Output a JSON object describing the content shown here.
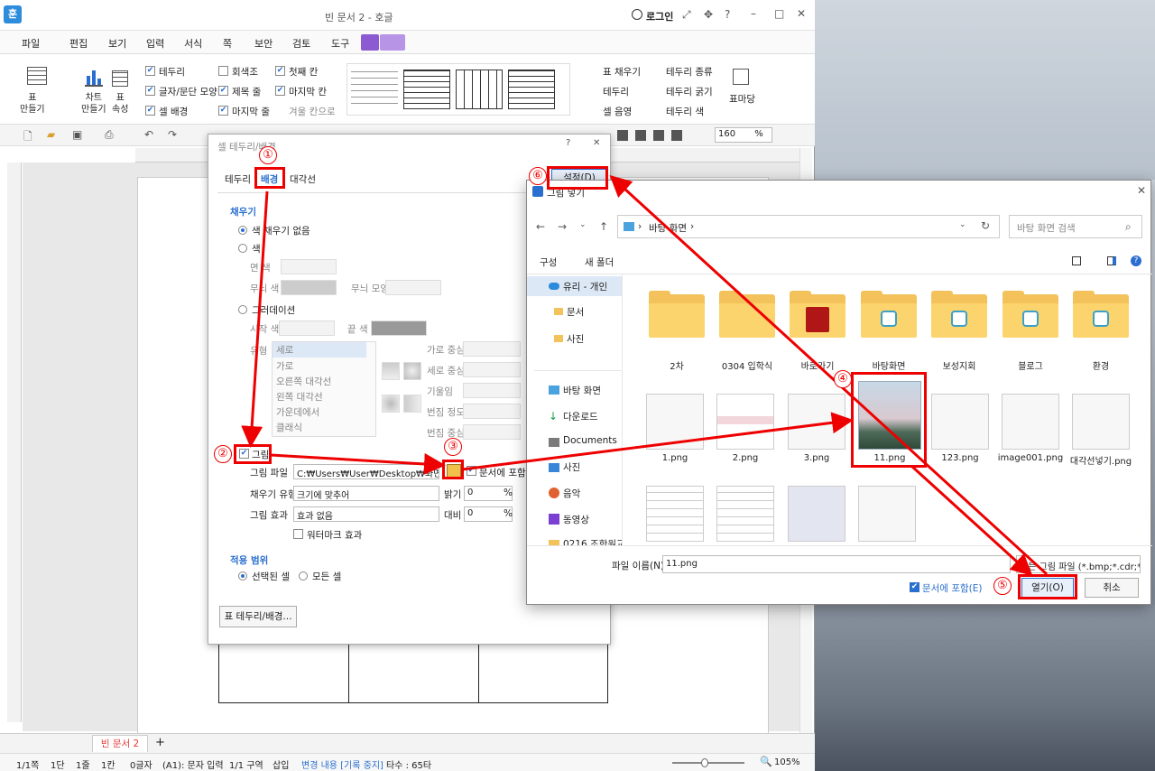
{
  "app": {
    "title": "빈 문서 2 - 호글",
    "login": "로그인",
    "logo": "훈"
  },
  "menu": [
    "파일",
    "편집",
    "보기",
    "입력",
    "서식",
    "쪽",
    "보안",
    "검토",
    "도구"
  ],
  "ribbon": {
    "table_make": "표\n만들기",
    "chart_make": "차트\n만들기",
    "table_prop": "표\n속성",
    "checks_col1": [
      "테두리",
      "글자/문단 모양",
      "셀 배경"
    ],
    "checks_col2": [
      "회색조",
      "제목 줄",
      "마지막 줄"
    ],
    "checks_col3": [
      "첫째 칸",
      "마지막 칸",
      "겨울 칸으로"
    ],
    "right_items": [
      "표 채우기",
      "테두리",
      "셀 음영",
      "테두리 종류",
      "테두리 굵기",
      "테두리 색",
      "표마당"
    ]
  },
  "toolbar2": {
    "zoom": "160",
    "zoom_unit": "%"
  },
  "tabs": {
    "doc_tab": "빈 문서 2"
  },
  "status": {
    "items": [
      "1/1쪽",
      "1단",
      "1줄",
      "1칸",
      "0글자",
      "(A1): 문자 입력",
      "1/1 구역",
      "삽입",
      "변경 내용 [기록 중지]",
      "타수 : 65타"
    ],
    "zoom": "105%"
  },
  "cell_dialog": {
    "title": "셀 테두리/배경",
    "tabs": [
      "테두리",
      "배경",
      "대각선"
    ],
    "settings_button": "설정(D)",
    "fill_section": "채우기",
    "no_fill": "색 채우기 없음",
    "color": "색",
    "face_label": "면 색",
    "pattern_color": "무늬 색",
    "pattern_shape": "무늬 모양",
    "gradation": "그러데이션",
    "start_color": "시작 색",
    "end_color": "끝 색",
    "type_label": "유형",
    "grad_types": [
      "세로",
      "가로",
      "오른쪽 대각선",
      "왼쪽 대각선",
      "가운데에서",
      "클래식"
    ],
    "grad_fields": [
      "가로 중심",
      "세로 중심",
      "기울임",
      "번짐 정도",
      "번짐 중심"
    ],
    "picture": "그림",
    "picture_file_label": "그림 파일",
    "picture_file_value": "C:₩Users₩User₩Desktop₩화면 캡",
    "include_doc": "문서에 포함",
    "fill_type_label": "채우기 유형",
    "fill_type_value": "크기에 맞추어",
    "brightness_label": "밝기",
    "brightness_value": "0",
    "effect_label": "그림 효과",
    "effect_value": "효과 없음",
    "contrast_label": "대비",
    "contrast_value": "0",
    "percent": "%",
    "watermark": "워터마크 효과",
    "scope_section": "적용 범위",
    "selected_cell": "선택된 셀",
    "all_cells": "모든 셀",
    "footer_button": "표 테두리/배경..."
  },
  "file_dialog": {
    "title": "그림 넣기",
    "path": [
      "바탕 화면"
    ],
    "search_placeholder": "바탕 화면 검색",
    "organize": "구성",
    "new_folder": "새 폴더",
    "nav": [
      "유리 - 개인",
      "문서",
      "사진",
      "바탕 화면",
      "다운로드",
      "Documents",
      "사진",
      "음악",
      "동영상",
      "0216 조한원교"
    ],
    "folders": [
      "2차",
      "0304 입학식",
      "바로가기",
      "바탕화면",
      "보성지회",
      "블로그",
      "환경"
    ],
    "files_row2": [
      "1.png",
      "2.png",
      "3.png",
      "11.png",
      "123.png",
      "image001.png",
      "대각선넣기.png"
    ],
    "filename_label": "파일 이름(N):",
    "filename_value": "11.png",
    "filter_value": "모든 그림 파일 (*.bmp;*.cdr;*.c",
    "include_doc": "문서에 포함(E)",
    "open_button": "열기(O)",
    "cancel_button": "취소"
  },
  "annotations": [
    "①",
    "②",
    "③",
    "④",
    "⑤",
    "⑥"
  ],
  "colors": {
    "accent": "#2a6fcf",
    "annotation": "#e00000",
    "tab_active": "#e53935"
  }
}
